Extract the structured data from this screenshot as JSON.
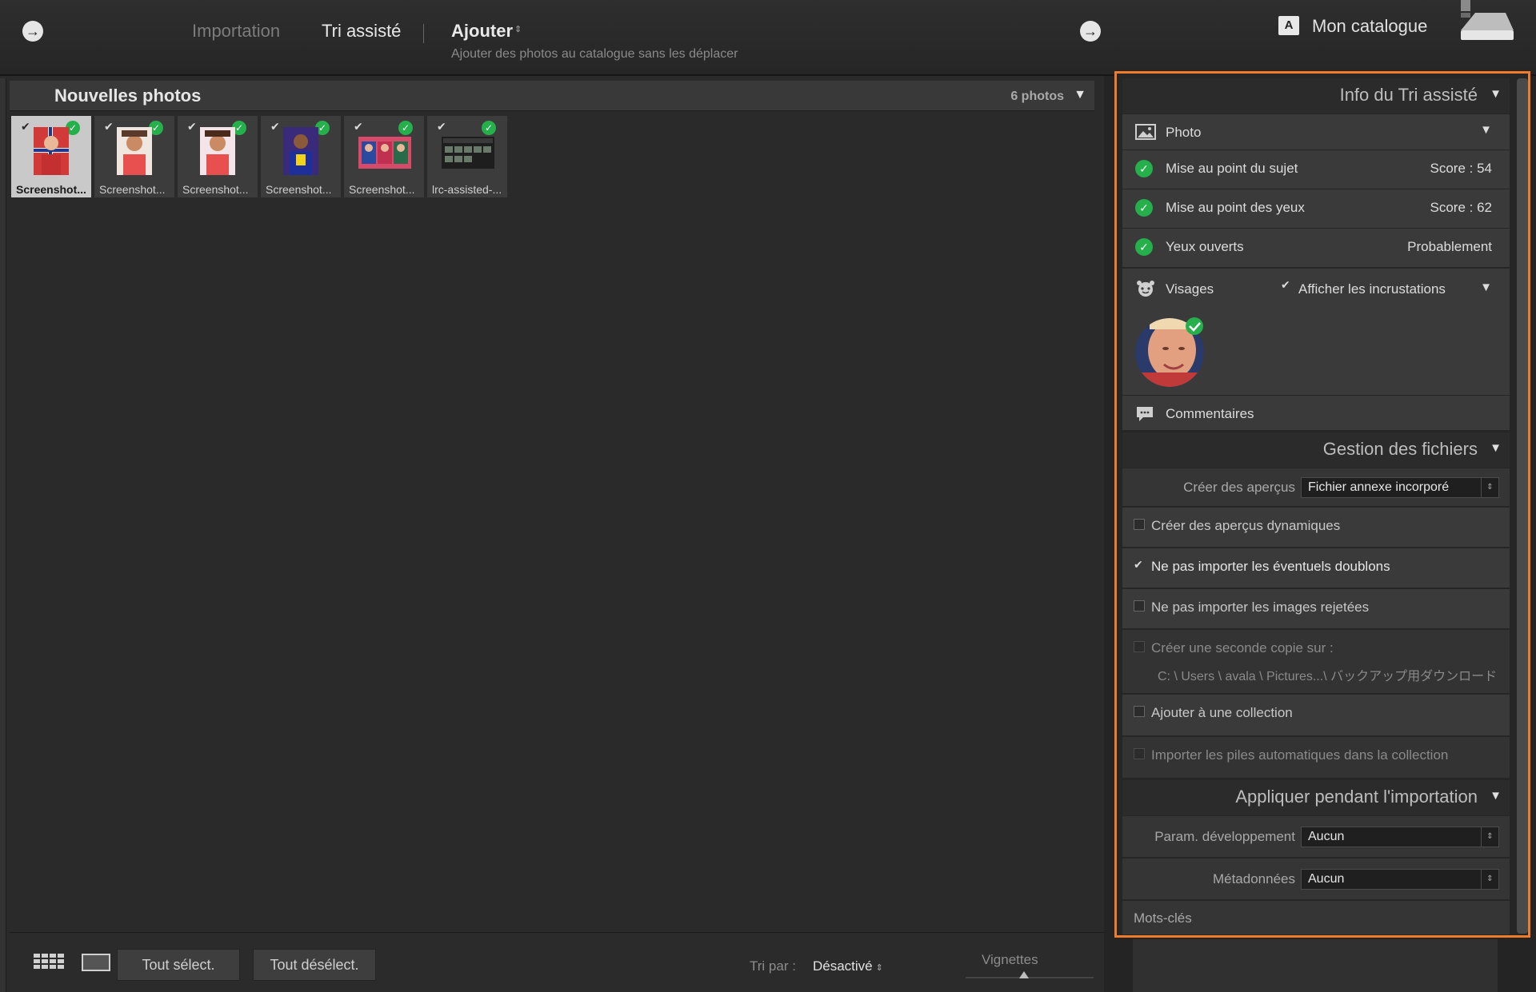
{
  "topbar": {
    "tab_importation": "Importation",
    "tab_tri": "Tri assisté",
    "tab_ajouter": "Ajouter",
    "ajouter_subtitle": "Ajouter des photos au catalogue sans les déplacer",
    "catalog_badge": "A",
    "catalog_name": "Mon catalogue"
  },
  "grid": {
    "title": "Nouvelles photos",
    "count": "6 photos",
    "thumbnails": [
      {
        "caption": "Screenshot...",
        "selected": true
      },
      {
        "caption": "Screenshot...",
        "selected": false
      },
      {
        "caption": "Screenshot...",
        "selected": false
      },
      {
        "caption": "Screenshot...",
        "selected": false
      },
      {
        "caption": "Screenshot...",
        "selected": false
      },
      {
        "caption": "lrc-assisted-...",
        "selected": false
      }
    ]
  },
  "bottombar": {
    "select_all": "Tout sélect.",
    "deselect_all": "Tout désélect.",
    "sort_label": "Tri par :",
    "sort_value": "Désactivé",
    "vignettes_label": "Vignettes"
  },
  "panel": {
    "info_title": "Info du Tri assisté",
    "photo_label": "Photo",
    "checks": [
      {
        "label": "Mise au point du sujet",
        "value": "Score : 54"
      },
      {
        "label": "Mise au point des yeux",
        "value": "Score : 62"
      },
      {
        "label": "Yeux ouverts",
        "value": "Probablement"
      }
    ],
    "faces_label": "Visages",
    "show_overlays": "Afficher les incrustations",
    "comments_label": "Commentaires",
    "files_title": "Gestion des fichiers",
    "previews_label": "Créer des aperçus",
    "previews_value": "Fichier annexe incorporé",
    "options": [
      {
        "label": "Créer des aperçus dynamiques",
        "checked": false
      },
      {
        "label": "Ne pas importer les éventuels doublons",
        "checked": true
      },
      {
        "label": "Ne pas importer les images rejetées",
        "checked": false
      }
    ],
    "second_copy_label": "Créer une seconde copie sur :",
    "second_copy_path": "C: \\ Users \\ avala \\ Pictures...\\ バックアップ用ダウンロード",
    "add_collection": "Ajouter à une collection",
    "import_stacks": "Importer les piles automatiques dans la collection",
    "apply_title": "Appliquer pendant l'importation",
    "dev_label": "Param. développement",
    "dev_value": "Aucun",
    "meta_label": "Métadonnées",
    "meta_value": "Aucun",
    "keywords_label": "Mots-clés"
  },
  "colors": {
    "accent_outline": "#f07b2a",
    "check_green": "#25b04b"
  }
}
